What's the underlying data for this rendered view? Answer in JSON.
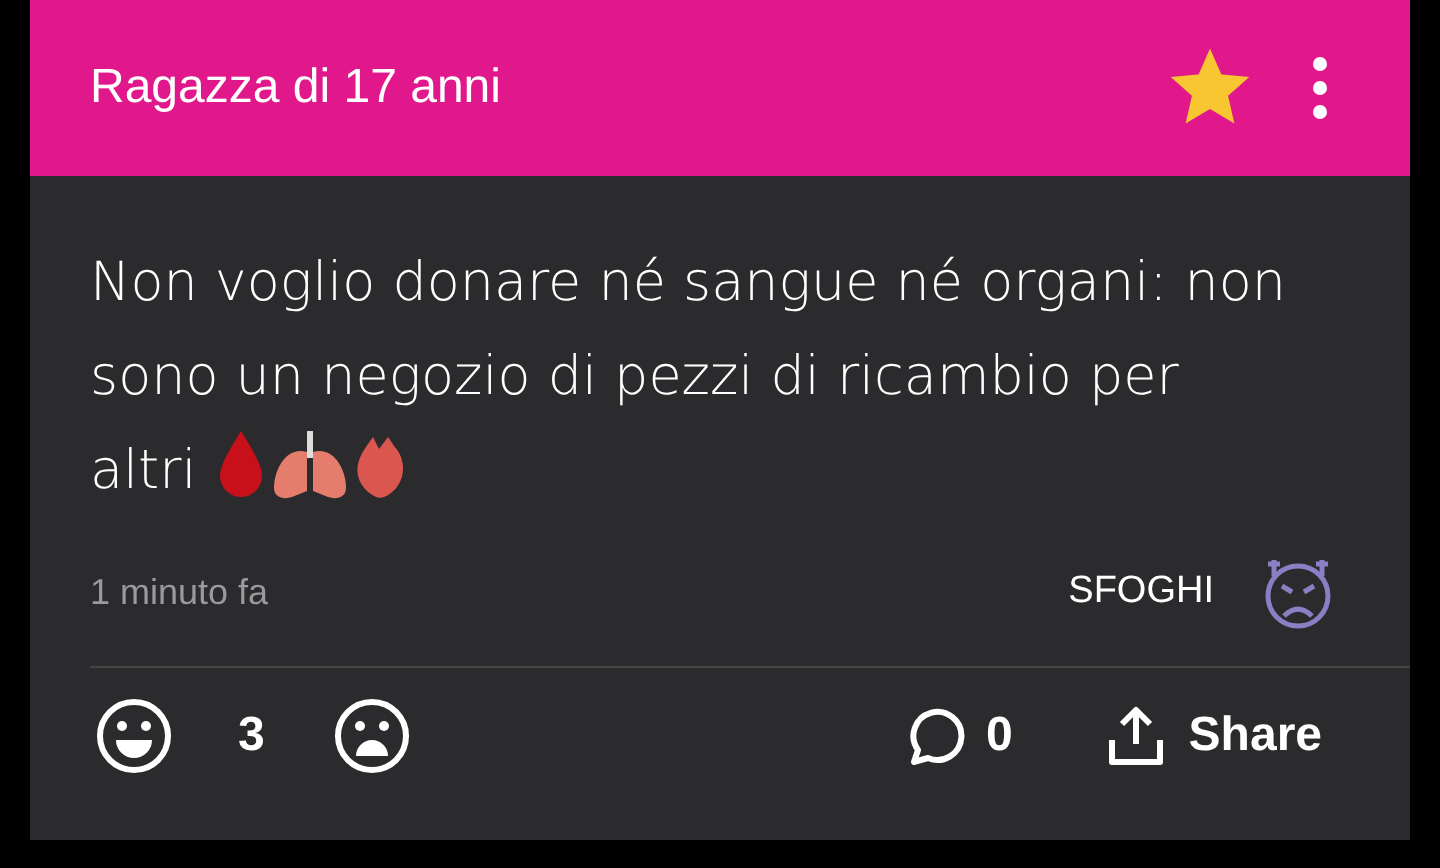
{
  "post": {
    "author": "Ragazza di 17 anni",
    "starred": true,
    "text": "Non voglio donare né sangue né organi: non sono un negozio di pezzi di ricambio per altri",
    "time": "1 minuto fa",
    "category": "SFOGHI"
  },
  "actions": {
    "likes": "3",
    "comments": "0",
    "share": "Share"
  }
}
